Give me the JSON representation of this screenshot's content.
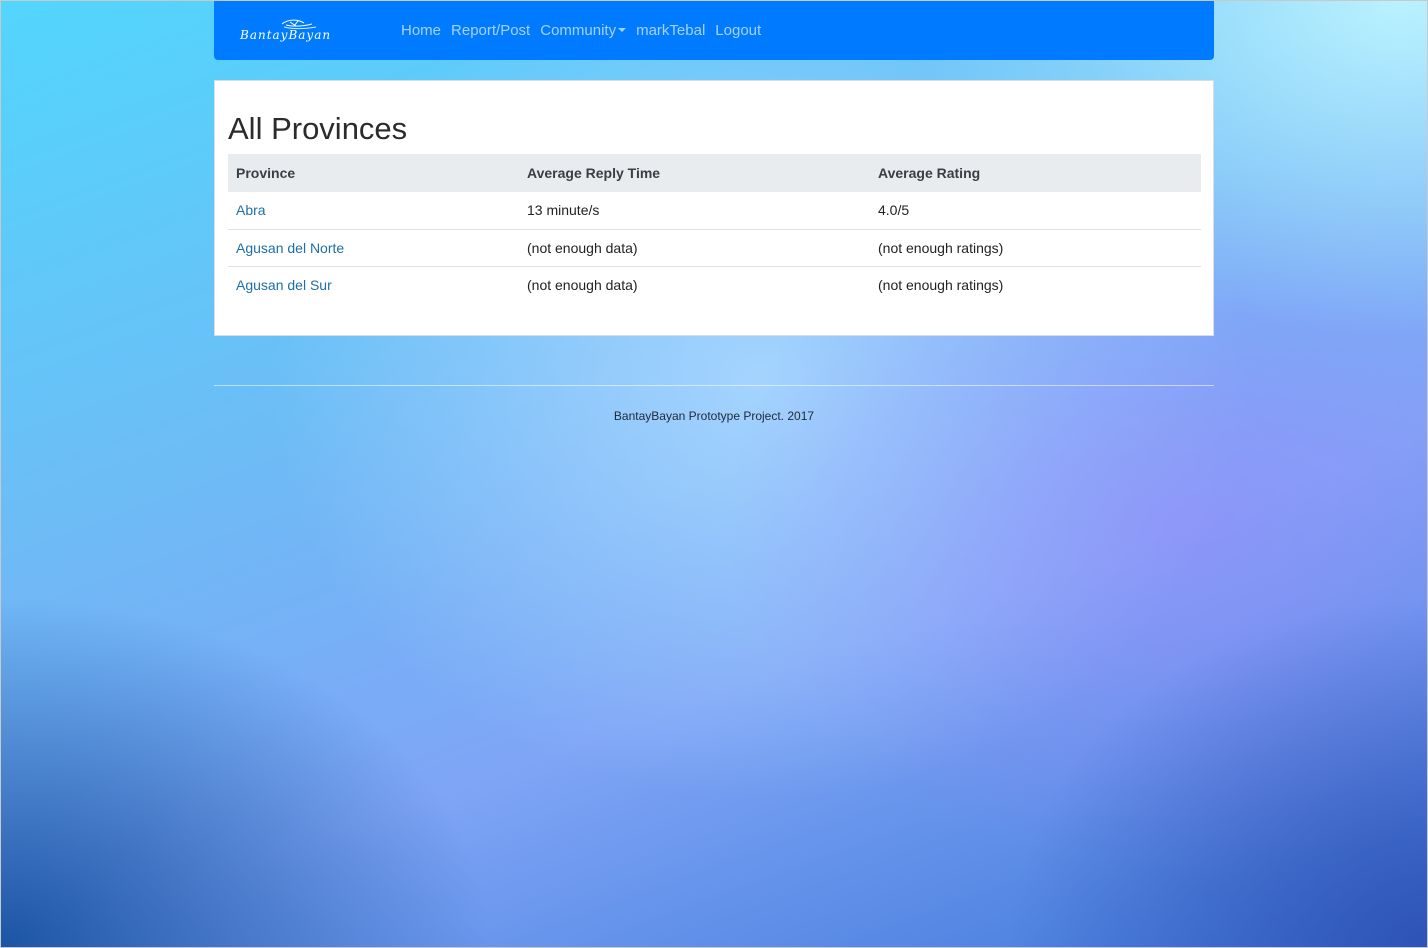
{
  "navbar": {
    "brand_name": "BantayBayan",
    "links": [
      {
        "label": "Home"
      },
      {
        "label": "Report/Post"
      },
      {
        "label": "Community"
      },
      {
        "label": "markTebal"
      },
      {
        "label": "Logout"
      }
    ],
    "background_color": "#007bff"
  },
  "main": {
    "title": "All Provinces",
    "table": {
      "headers": [
        "Province",
        "Average Reply Time",
        "Average Rating"
      ],
      "rows": [
        {
          "province": "Abra",
          "reply_time": "13 minute/s",
          "rating": "4.0/5"
        },
        {
          "province": "Agusan del Norte",
          "reply_time": "(not enough data)",
          "rating": "(not enough ratings)"
        },
        {
          "province": "Agusan del Sur",
          "reply_time": "(not enough data)",
          "rating": "(not enough ratings)"
        }
      ]
    }
  },
  "footer": {
    "text": "BantayBayan Prototype Project. 2017"
  }
}
